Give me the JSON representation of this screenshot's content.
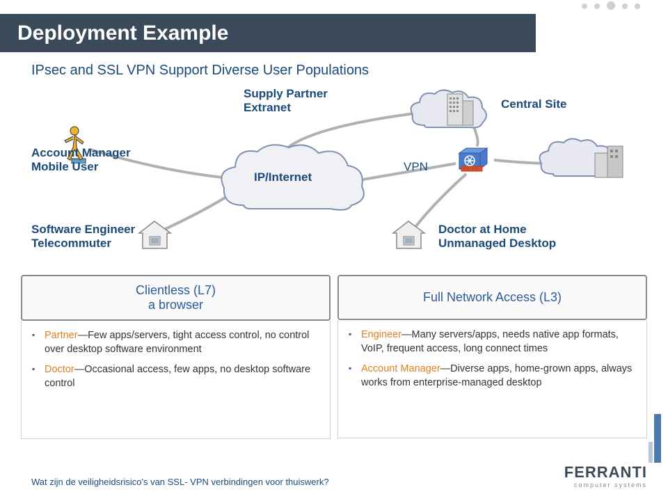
{
  "title": "Deployment Example",
  "subtitle": "IPsec and SSL VPN Support Diverse User Populations",
  "diagram": {
    "account_manager_l1": "Account Manager",
    "account_manager_l2": "Mobile User",
    "supply_partner_l1": "Supply Partner",
    "supply_partner_l2": "Extranet",
    "cloud_label": "IP/Internet",
    "vpn_label": "VPN",
    "central_site": "Central Site",
    "doctor_l1": "Doctor at Home",
    "doctor_l2": "Unmanaged Desktop",
    "engineer_l1": "Software Engineer",
    "engineer_l2": "Telecommuter"
  },
  "table": {
    "left": {
      "head_l1": "Clientless (L7)",
      "head_l2": "a browser",
      "items": [
        {
          "hl": "Partner",
          "rest": "—Few apps/servers, tight access control, no control over desktop software environment"
        },
        {
          "hl": "Doctor",
          "rest": "—Occasional access, few apps, no desktop software control"
        }
      ]
    },
    "right": {
      "head_l1": "Full Network Access (L3)",
      "items": [
        {
          "hl": "Engineer",
          "rest": "—Many servers/apps, needs native app formats, VoIP, frequent access, long connect times"
        },
        {
          "hl": "Account Manager",
          "rest": "—Diverse apps, home-grown apps, always works from enterprise-managed desktop"
        }
      ]
    }
  },
  "footer": "Wat zijn de veiligheidsrisico's van SSL- VPN verbindingen voor thuiswerk?",
  "logo": {
    "main": "FERRANTI",
    "sub": "computer systems"
  }
}
